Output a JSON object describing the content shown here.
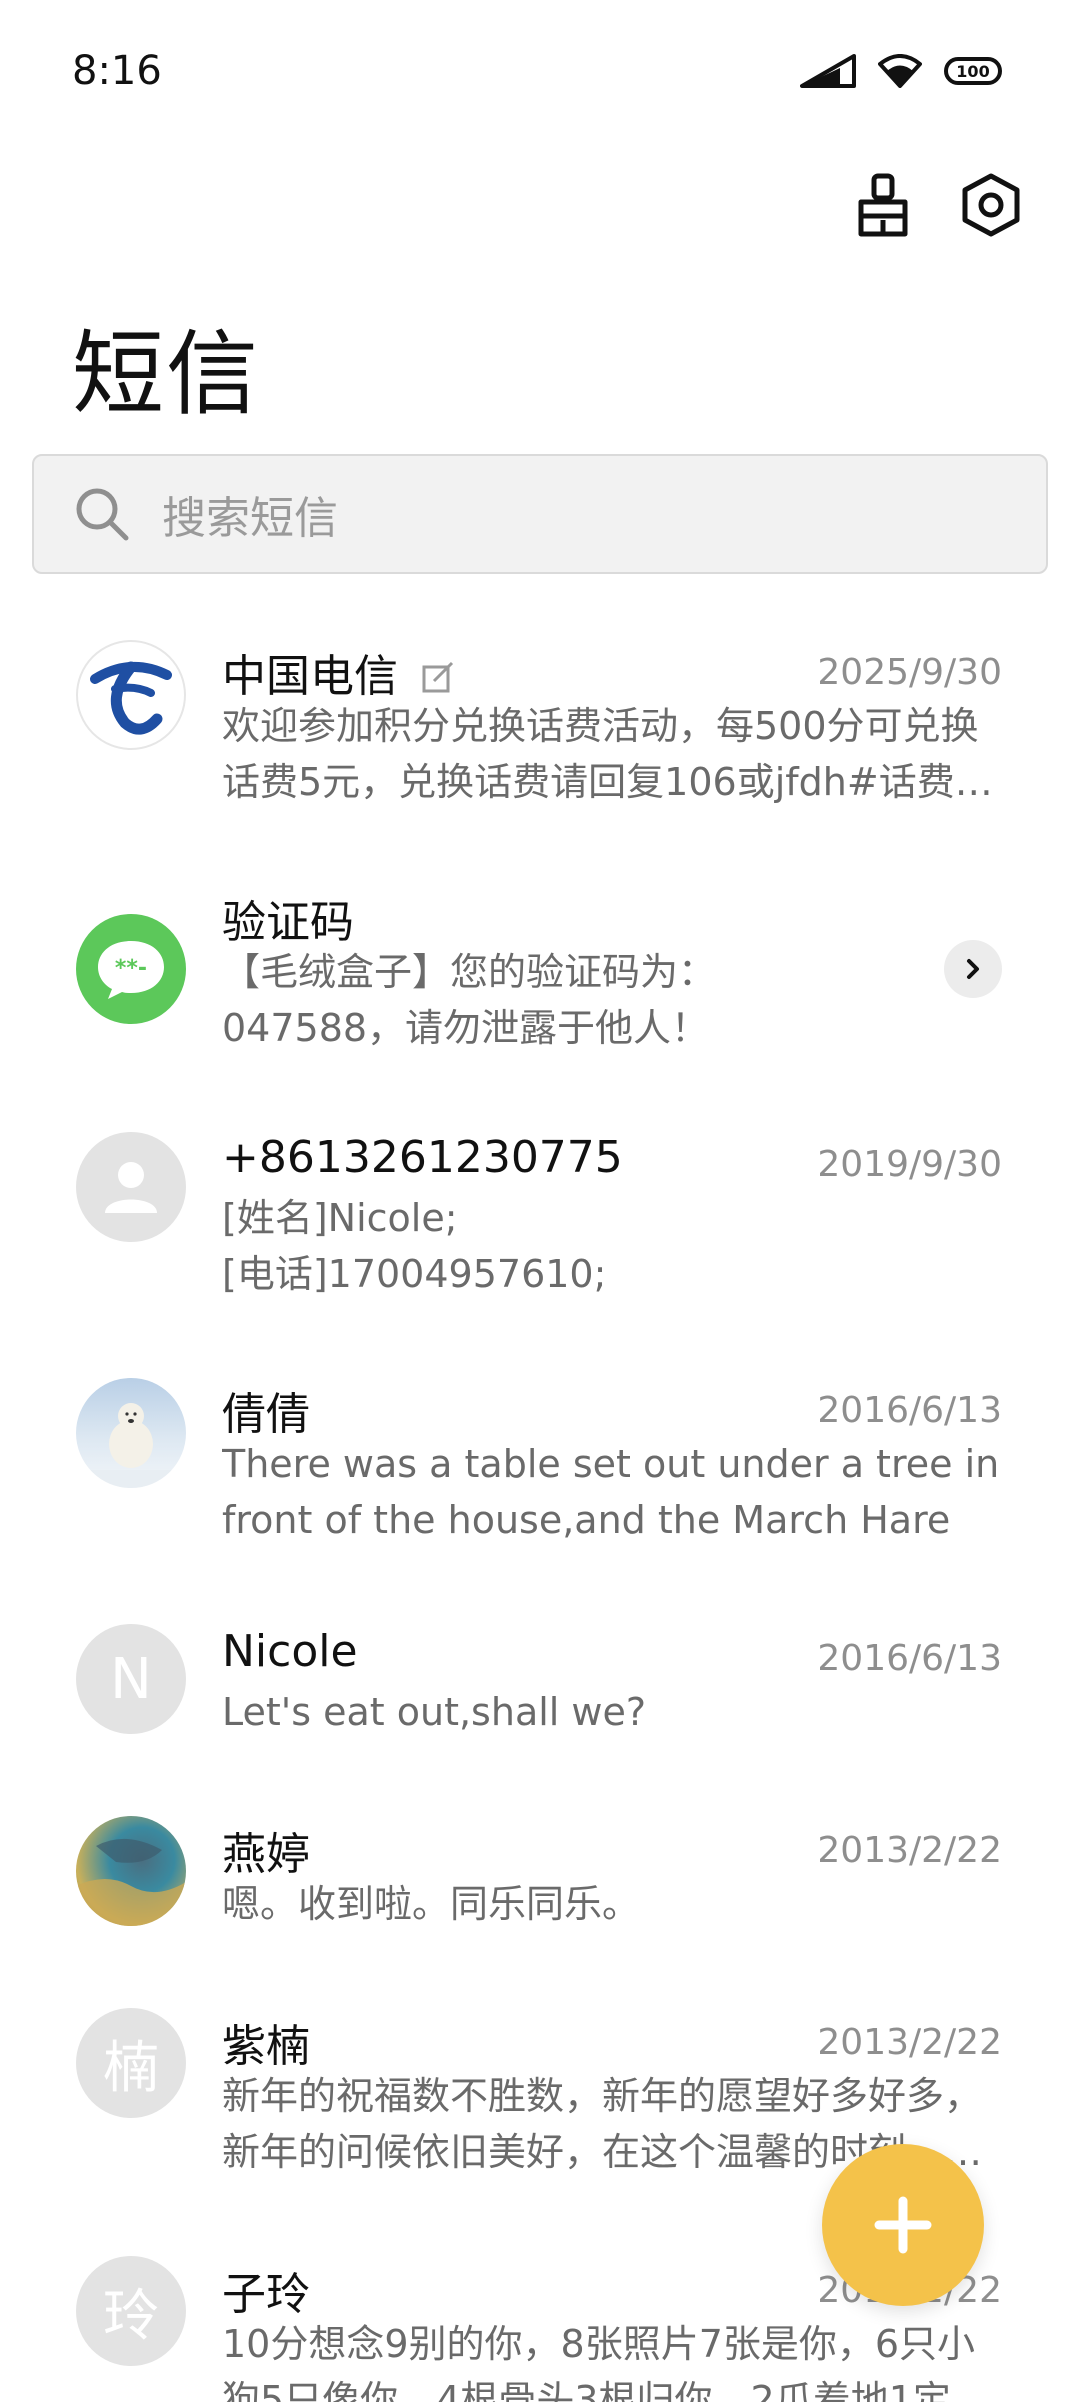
{
  "status_bar": {
    "time": "8:16",
    "battery": "100"
  },
  "header": {
    "title": "短信"
  },
  "search": {
    "placeholder": "搜索短信"
  },
  "conversations": [
    {
      "name": "中国电信",
      "date": "2025/9/30",
      "preview": "欢迎参加积分兑换话费活动，每500分可兑换\n话费5元，兑换话费请回复106或jfdh#话费…",
      "avatar": "china-telecom-logo",
      "has_draft": true
    },
    {
      "name": "验证码",
      "date": "",
      "preview": "【毛绒盒子】您的验证码为：\n047588，请勿泄露于他人！",
      "avatar": "verification-code-icon"
    },
    {
      "name": "+8613261230775",
      "date": "2019/9/30",
      "preview": "[姓名]Nicole;\n[电话]17004957610;",
      "avatar": "default-person-icon"
    },
    {
      "name": "倩倩",
      "date": "2016/6/13",
      "preview": "There was a table set out under a tree in\nfront of the house,and the March Hare an…",
      "avatar": "polar-bear-photo"
    },
    {
      "name": "Nicole",
      "date": "2016/6/13",
      "preview": "Let's eat out,shall we?",
      "avatar_letter": "N"
    },
    {
      "name": "燕婷",
      "date": "2013/2/22",
      "preview": "嗯。收到啦。同乐同乐。",
      "avatar": "landscape-photo"
    },
    {
      "name": "紫楠",
      "date": "2013/2/22",
      "preview": "新年的祝福数不胜数，新年的愿望好多好多，\n新年的问候依旧美好，在这个温馨的时刻，…",
      "avatar_letter": "楠"
    },
    {
      "name": "子玲",
      "date": "2013/2/22",
      "preview": "10分想念9别的你，8张照片7张是你，6只小\n狗5只像你，4根骨头3根归你，2爪着地1定",
      "avatar_letter": "玲"
    }
  ],
  "colors": {
    "accent_fab": "#f4c24a",
    "verification_green": "#5cc85a",
    "avatar_gray": "#e3e3e3",
    "telecom_blue": "#1f4fa3"
  }
}
